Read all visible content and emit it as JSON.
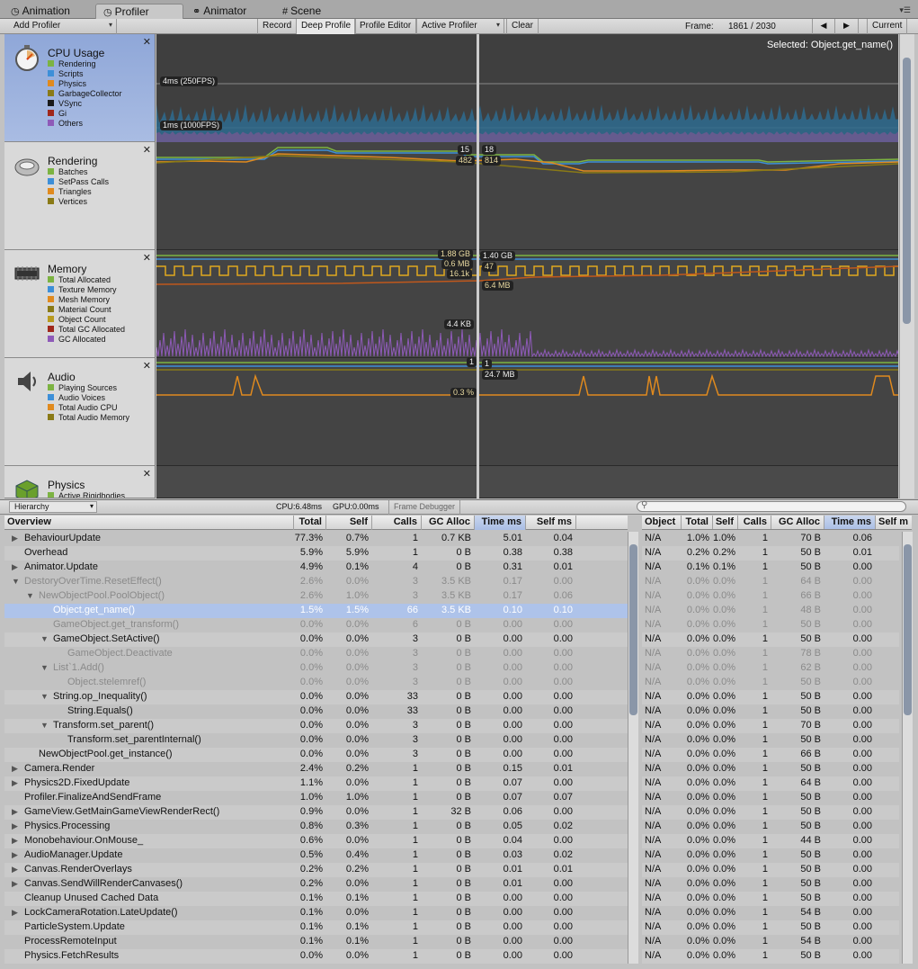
{
  "tabs": [
    {
      "icon": "clock-icon",
      "glyph": "◷",
      "label": "Animation"
    },
    {
      "icon": "profiler-icon",
      "glyph": "◷",
      "label": "Profiler"
    },
    {
      "icon": "animator-icon",
      "glyph": "⚭",
      "label": "Animator"
    },
    {
      "icon": "scene-icon",
      "glyph": "#",
      "label": "Scene"
    }
  ],
  "toolbar": {
    "add_profiler": "Add Profiler",
    "record": "Record",
    "deep_profile": "Deep Profile",
    "profile_editor": "Profile Editor",
    "active_profiler": "Active Profiler",
    "clear": "Clear",
    "frame_label": "Frame:",
    "frame_value": "1861 / 2030",
    "prev": "◀",
    "next": "▶",
    "current": "Current"
  },
  "selected": "Selected: Object.get_name()",
  "modules": [
    {
      "title": "CPU Usage",
      "items": [
        {
          "label": "Rendering",
          "color": "#7cb342"
        },
        {
          "label": "Scripts",
          "color": "#3d8fd8"
        },
        {
          "label": "Physics",
          "color": "#e08a1e"
        },
        {
          "label": "GarbageCollector",
          "color": "#8a7a16"
        },
        {
          "label": "VSync",
          "color": "#1a1a1a"
        },
        {
          "label": "Gi",
          "color": "#a0281c"
        },
        {
          "label": "Others",
          "color": "#8e5ab8"
        }
      ]
    },
    {
      "title": "Rendering",
      "items": [
        {
          "label": "Batches",
          "color": "#7cb342"
        },
        {
          "label": "SetPass Calls",
          "color": "#3d8fd8"
        },
        {
          "label": "Triangles",
          "color": "#e08a1e"
        },
        {
          "label": "Vertices",
          "color": "#8a7a16"
        }
      ]
    },
    {
      "title": "Memory",
      "items": [
        {
          "label": "Total Allocated",
          "color": "#7cb342"
        },
        {
          "label": "Texture Memory",
          "color": "#3d8fd8"
        },
        {
          "label": "Mesh Memory",
          "color": "#e08a1e"
        },
        {
          "label": "Material Count",
          "color": "#8a7a16"
        },
        {
          "label": "Object Count",
          "color": "#b89a20"
        },
        {
          "label": "Total GC Allocated",
          "color": "#a0281c"
        },
        {
          "label": "GC Allocated",
          "color": "#8e5ab8"
        }
      ]
    },
    {
      "title": "Audio",
      "items": [
        {
          "label": "Playing Sources",
          "color": "#7cb342"
        },
        {
          "label": "Audio Voices",
          "color": "#3d8fd8"
        },
        {
          "label": "Total Audio CPU",
          "color": "#e08a1e"
        },
        {
          "label": "Total Audio Memory",
          "color": "#8a7a16"
        }
      ]
    },
    {
      "title": "Physics",
      "items": [
        {
          "label": "Active Rigidbodies",
          "color": "#7cb342"
        }
      ]
    }
  ],
  "graph_labels": {
    "cpu_4ms": "4ms (250FPS)",
    "cpu_1ms": "1ms (1000FPS)",
    "r_15": "15",
    "r_18": "18",
    "r_482": "482",
    "r_814": "814",
    "m_188": "1.88 GB",
    "m_140": "1.40 GB",
    "m_06": "0.6 MB",
    "m_47": "47",
    "m_161": "16.1k",
    "m_64": "6.4 MB",
    "m_44": "4.4 KB",
    "a_1a": "1",
    "a_1b": "1",
    "a_247": "24.7 MB",
    "a_03": "0.3 %"
  },
  "bottom_toolbar": {
    "hierarchy": "Hierarchy",
    "cpu": "CPU:6.48ms",
    "gpu": "GPU:0.00ms",
    "frame_debugger": "Frame Debugger"
  },
  "left_table": {
    "headers": [
      "Overview",
      "Total",
      "Self",
      "Calls",
      "GC Alloc",
      "Time ms",
      "Self ms"
    ],
    "rows": [
      {
        "name": "BehaviourUpdate",
        "indent": 0,
        "tri": "▶",
        "total": "77.3%",
        "self": "0.7%",
        "calls": "1",
        "gc": "0.7 KB",
        "time": "5.01",
        "selfms": "0.04",
        "style": ""
      },
      {
        "name": "Overhead",
        "indent": 0,
        "tri": "",
        "total": "5.9%",
        "self": "5.9%",
        "calls": "1",
        "gc": "0 B",
        "time": "0.38",
        "selfms": "0.38",
        "style": ""
      },
      {
        "name": "Animator.Update",
        "indent": 0,
        "tri": "▶",
        "total": "4.9%",
        "self": "0.1%",
        "calls": "4",
        "gc": "0 B",
        "time": "0.31",
        "selfms": "0.01",
        "style": ""
      },
      {
        "name": "DestoryOverTime.ResetEffect()",
        "indent": 0,
        "tri": "▼",
        "total": "2.6%",
        "self": "0.0%",
        "calls": "3",
        "gc": "3.5 KB",
        "time": "0.17",
        "selfms": "0.00",
        "style": "dim"
      },
      {
        "name": "NewObjectPool.PoolObject()",
        "indent": 1,
        "tri": "▼",
        "total": "2.6%",
        "self": "1.0%",
        "calls": "3",
        "gc": "3.5 KB",
        "time": "0.17",
        "selfms": "0.06",
        "style": "dim"
      },
      {
        "name": "Object.get_name()",
        "indent": 2,
        "tri": "",
        "total": "1.5%",
        "self": "1.5%",
        "calls": "66",
        "gc": "3.5 KB",
        "time": "0.10",
        "selfms": "0.10",
        "style": "sel"
      },
      {
        "name": "GameObject.get_transform()",
        "indent": 2,
        "tri": "",
        "total": "0.0%",
        "self": "0.0%",
        "calls": "6",
        "gc": "0 B",
        "time": "0.00",
        "selfms": "0.00",
        "style": "dim"
      },
      {
        "name": "GameObject.SetActive()",
        "indent": 2,
        "tri": "▼",
        "total": "0.0%",
        "self": "0.0%",
        "calls": "3",
        "gc": "0 B",
        "time": "0.00",
        "selfms": "0.00",
        "style": ""
      },
      {
        "name": "GameObject.Deactivate",
        "indent": 3,
        "tri": "",
        "total": "0.0%",
        "self": "0.0%",
        "calls": "3",
        "gc": "0 B",
        "time": "0.00",
        "selfms": "0.00",
        "style": "dim"
      },
      {
        "name": "List`1.Add()",
        "indent": 2,
        "tri": "▼",
        "total": "0.0%",
        "self": "0.0%",
        "calls": "3",
        "gc": "0 B",
        "time": "0.00",
        "selfms": "0.00",
        "style": "dim"
      },
      {
        "name": "Object.stelemref()",
        "indent": 3,
        "tri": "",
        "total": "0.0%",
        "self": "0.0%",
        "calls": "3",
        "gc": "0 B",
        "time": "0.00",
        "selfms": "0.00",
        "style": "dim"
      },
      {
        "name": "String.op_Inequality()",
        "indent": 2,
        "tri": "▼",
        "total": "0.0%",
        "self": "0.0%",
        "calls": "33",
        "gc": "0 B",
        "time": "0.00",
        "selfms": "0.00",
        "style": ""
      },
      {
        "name": "String.Equals()",
        "indent": 3,
        "tri": "",
        "total": "0.0%",
        "self": "0.0%",
        "calls": "33",
        "gc": "0 B",
        "time": "0.00",
        "selfms": "0.00",
        "style": ""
      },
      {
        "name": "Transform.set_parent()",
        "indent": 2,
        "tri": "▼",
        "total": "0.0%",
        "self": "0.0%",
        "calls": "3",
        "gc": "0 B",
        "time": "0.00",
        "selfms": "0.00",
        "style": ""
      },
      {
        "name": "Transform.set_parentInternal()",
        "indent": 3,
        "tri": "",
        "total": "0.0%",
        "self": "0.0%",
        "calls": "3",
        "gc": "0 B",
        "time": "0.00",
        "selfms": "0.00",
        "style": ""
      },
      {
        "name": "NewObjectPool.get_instance()",
        "indent": 1,
        "tri": "",
        "total": "0.0%",
        "self": "0.0%",
        "calls": "3",
        "gc": "0 B",
        "time": "0.00",
        "selfms": "0.00",
        "style": ""
      },
      {
        "name": "Camera.Render",
        "indent": 0,
        "tri": "▶",
        "total": "2.4%",
        "self": "0.2%",
        "calls": "1",
        "gc": "0 B",
        "time": "0.15",
        "selfms": "0.01",
        "style": ""
      },
      {
        "name": "Physics2D.FixedUpdate",
        "indent": 0,
        "tri": "▶",
        "total": "1.1%",
        "self": "0.0%",
        "calls": "1",
        "gc": "0 B",
        "time": "0.07",
        "selfms": "0.00",
        "style": ""
      },
      {
        "name": "Profiler.FinalizeAndSendFrame",
        "indent": 0,
        "tri": "",
        "total": "1.0%",
        "self": "1.0%",
        "calls": "1",
        "gc": "0 B",
        "time": "0.07",
        "selfms": "0.07",
        "style": ""
      },
      {
        "name": "GameView.GetMainGameViewRenderRect()",
        "indent": 0,
        "tri": "▶",
        "total": "0.9%",
        "self": "0.0%",
        "calls": "1",
        "gc": "32 B",
        "time": "0.06",
        "selfms": "0.00",
        "style": ""
      },
      {
        "name": "Physics.Processing",
        "indent": 0,
        "tri": "▶",
        "total": "0.8%",
        "self": "0.3%",
        "calls": "1",
        "gc": "0 B",
        "time": "0.05",
        "selfms": "0.02",
        "style": ""
      },
      {
        "name": "Monobehaviour.OnMouse_",
        "indent": 0,
        "tri": "▶",
        "total": "0.6%",
        "self": "0.0%",
        "calls": "1",
        "gc": "0 B",
        "time": "0.04",
        "selfms": "0.00",
        "style": ""
      },
      {
        "name": "AudioManager.Update",
        "indent": 0,
        "tri": "▶",
        "total": "0.5%",
        "self": "0.4%",
        "calls": "1",
        "gc": "0 B",
        "time": "0.03",
        "selfms": "0.02",
        "style": ""
      },
      {
        "name": "Canvas.RenderOverlays",
        "indent": 0,
        "tri": "▶",
        "total": "0.2%",
        "self": "0.2%",
        "calls": "1",
        "gc": "0 B",
        "time": "0.01",
        "selfms": "0.01",
        "style": ""
      },
      {
        "name": "Canvas.SendWillRenderCanvases()",
        "indent": 0,
        "tri": "▶",
        "total": "0.2%",
        "self": "0.0%",
        "calls": "1",
        "gc": "0 B",
        "time": "0.01",
        "selfms": "0.00",
        "style": ""
      },
      {
        "name": "Cleanup Unused Cached Data",
        "indent": 0,
        "tri": "",
        "total": "0.1%",
        "self": "0.1%",
        "calls": "1",
        "gc": "0 B",
        "time": "0.00",
        "selfms": "0.00",
        "style": ""
      },
      {
        "name": "LockCameraRotation.LateUpdate()",
        "indent": 0,
        "tri": "▶",
        "total": "0.1%",
        "self": "0.0%",
        "calls": "1",
        "gc": "0 B",
        "time": "0.00",
        "selfms": "0.00",
        "style": ""
      },
      {
        "name": "ParticleSystem.Update",
        "indent": 0,
        "tri": "",
        "total": "0.1%",
        "self": "0.1%",
        "calls": "1",
        "gc": "0 B",
        "time": "0.00",
        "selfms": "0.00",
        "style": ""
      },
      {
        "name": "ProcessRemoteInput",
        "indent": 0,
        "tri": "",
        "total": "0.1%",
        "self": "0.1%",
        "calls": "1",
        "gc": "0 B",
        "time": "0.00",
        "selfms": "0.00",
        "style": ""
      },
      {
        "name": "Physics.FetchResults",
        "indent": 0,
        "tri": "",
        "total": "0.0%",
        "self": "0.0%",
        "calls": "1",
        "gc": "0 B",
        "time": "0.00",
        "selfms": "0.00",
        "style": ""
      }
    ]
  },
  "right_table": {
    "headers": [
      "Object",
      "Total",
      "Self",
      "Calls",
      "GC Alloc",
      "Time ms",
      "Self m"
    ],
    "rows": [
      {
        "obj": "N/A",
        "total": "1.0%",
        "self": "1.0%",
        "calls": "1",
        "gc": "70 B",
        "time": "0.06",
        "style": ""
      },
      {
        "obj": "N/A",
        "total": "0.2%",
        "self": "0.2%",
        "calls": "1",
        "gc": "50 B",
        "time": "0.01",
        "style": ""
      },
      {
        "obj": "N/A",
        "total": "0.1%",
        "self": "0.1%",
        "calls": "1",
        "gc": "50 B",
        "time": "0.00",
        "style": ""
      },
      {
        "obj": "N/A",
        "total": "0.0%",
        "self": "0.0%",
        "calls": "1",
        "gc": "64 B",
        "time": "0.00",
        "style": "dim"
      },
      {
        "obj": "N/A",
        "total": "0.0%",
        "self": "0.0%",
        "calls": "1",
        "gc": "66 B",
        "time": "0.00",
        "style": "dim"
      },
      {
        "obj": "N/A",
        "total": "0.0%",
        "self": "0.0%",
        "calls": "1",
        "gc": "48 B",
        "time": "0.00",
        "style": "dim"
      },
      {
        "obj": "N/A",
        "total": "0.0%",
        "self": "0.0%",
        "calls": "1",
        "gc": "50 B",
        "time": "0.00",
        "style": "dim"
      },
      {
        "obj": "N/A",
        "total": "0.0%",
        "self": "0.0%",
        "calls": "1",
        "gc": "50 B",
        "time": "0.00",
        "style": ""
      },
      {
        "obj": "N/A",
        "total": "0.0%",
        "self": "0.0%",
        "calls": "1",
        "gc": "78 B",
        "time": "0.00",
        "style": "dim"
      },
      {
        "obj": "N/A",
        "total": "0.0%",
        "self": "0.0%",
        "calls": "1",
        "gc": "62 B",
        "time": "0.00",
        "style": "dim"
      },
      {
        "obj": "N/A",
        "total": "0.0%",
        "self": "0.0%",
        "calls": "1",
        "gc": "50 B",
        "time": "0.00",
        "style": "dim"
      },
      {
        "obj": "N/A",
        "total": "0.0%",
        "self": "0.0%",
        "calls": "1",
        "gc": "50 B",
        "time": "0.00",
        "style": ""
      },
      {
        "obj": "N/A",
        "total": "0.0%",
        "self": "0.0%",
        "calls": "1",
        "gc": "50 B",
        "time": "0.00",
        "style": ""
      },
      {
        "obj": "N/A",
        "total": "0.0%",
        "self": "0.0%",
        "calls": "1",
        "gc": "70 B",
        "time": "0.00",
        "style": ""
      },
      {
        "obj": "N/A",
        "total": "0.0%",
        "self": "0.0%",
        "calls": "1",
        "gc": "50 B",
        "time": "0.00",
        "style": ""
      },
      {
        "obj": "N/A",
        "total": "0.0%",
        "self": "0.0%",
        "calls": "1",
        "gc": "66 B",
        "time": "0.00",
        "style": ""
      },
      {
        "obj": "N/A",
        "total": "0.0%",
        "self": "0.0%",
        "calls": "1",
        "gc": "50 B",
        "time": "0.00",
        "style": ""
      },
      {
        "obj": "N/A",
        "total": "0.0%",
        "self": "0.0%",
        "calls": "1",
        "gc": "64 B",
        "time": "0.00",
        "style": ""
      },
      {
        "obj": "N/A",
        "total": "0.0%",
        "self": "0.0%",
        "calls": "1",
        "gc": "50 B",
        "time": "0.00",
        "style": ""
      },
      {
        "obj": "N/A",
        "total": "0.0%",
        "self": "0.0%",
        "calls": "1",
        "gc": "50 B",
        "time": "0.00",
        "style": ""
      },
      {
        "obj": "N/A",
        "total": "0.0%",
        "self": "0.0%",
        "calls": "1",
        "gc": "50 B",
        "time": "0.00",
        "style": ""
      },
      {
        "obj": "N/A",
        "total": "0.0%",
        "self": "0.0%",
        "calls": "1",
        "gc": "44 B",
        "time": "0.00",
        "style": ""
      },
      {
        "obj": "N/A",
        "total": "0.0%",
        "self": "0.0%",
        "calls": "1",
        "gc": "50 B",
        "time": "0.00",
        "style": ""
      },
      {
        "obj": "N/A",
        "total": "0.0%",
        "self": "0.0%",
        "calls": "1",
        "gc": "50 B",
        "time": "0.00",
        "style": ""
      },
      {
        "obj": "N/A",
        "total": "0.0%",
        "self": "0.0%",
        "calls": "1",
        "gc": "50 B",
        "time": "0.00",
        "style": ""
      },
      {
        "obj": "N/A",
        "total": "0.0%",
        "self": "0.0%",
        "calls": "1",
        "gc": "50 B",
        "time": "0.00",
        "style": ""
      },
      {
        "obj": "N/A",
        "total": "0.0%",
        "self": "0.0%",
        "calls": "1",
        "gc": "54 B",
        "time": "0.00",
        "style": ""
      },
      {
        "obj": "N/A",
        "total": "0.0%",
        "self": "0.0%",
        "calls": "1",
        "gc": "50 B",
        "time": "0.00",
        "style": ""
      },
      {
        "obj": "N/A",
        "total": "0.0%",
        "self": "0.0%",
        "calls": "1",
        "gc": "54 B",
        "time": "0.00",
        "style": ""
      },
      {
        "obj": "N/A",
        "total": "0.0%",
        "self": "0.0%",
        "calls": "1",
        "gc": "50 B",
        "time": "0.00",
        "style": ""
      }
    ]
  }
}
